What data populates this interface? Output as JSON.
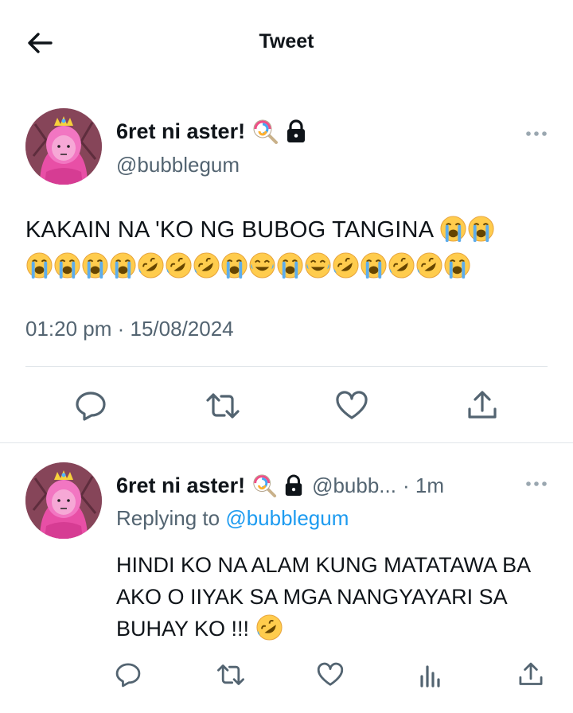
{
  "header": {
    "title": "Tweet"
  },
  "tweet": {
    "author_name": "6ret ni aster!",
    "handle": "@bubblegum",
    "text": "KAKAIN NA 'KO NG BUBOG TANGINA",
    "emojis_line1": [
      "loudly-crying-face",
      "loudly-crying-face"
    ],
    "emojis_line2": [
      "loudly-crying-face",
      "loudly-crying-face",
      "loudly-crying-face",
      "loudly-crying-face",
      "rolling-on-floor-laughing",
      "rolling-on-floor-laughing",
      "rolling-on-floor-laughing",
      "loudly-crying-face",
      "face-with-tears-of-joy",
      "loudly-crying-face",
      "face-with-tears-of-joy",
      "rolling-on-floor-laughing",
      "loudly-crying-face",
      "rolling-on-floor-laughing",
      "rolling-on-floor-laughing",
      "loudly-crying-face"
    ],
    "timestamp": "01:20 pm · 15/08/2024",
    "badges": [
      "lollipop-icon",
      "lock-icon"
    ]
  },
  "reply": {
    "author_name": "6ret ni aster!",
    "handle_truncated": "@bubb...",
    "time_ago": "· 1m",
    "replying_prefix": "Replying to",
    "replying_handle": "@bubblegum",
    "text": "HINDI KO NA ALAM KUNG MATATAWA BA AKO O IIYAK SA MGA NANGYAYARI SA BUHAY KO !!!",
    "trailing_emoji": "rolling-on-floor-laughing"
  },
  "colors": {
    "secondary_text": "#536471",
    "link": "#1d9bf0",
    "divider": "#e1e6ea"
  }
}
